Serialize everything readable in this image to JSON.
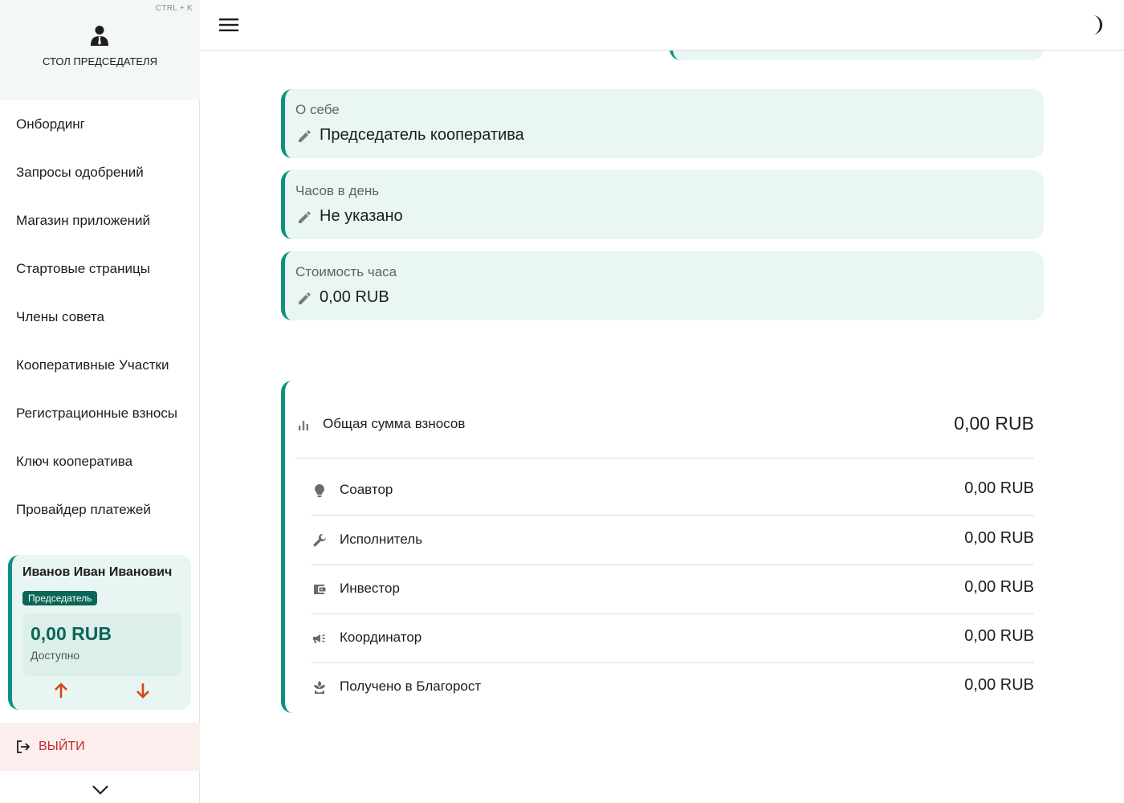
{
  "sidebar": {
    "shortcut": "CTRL + K",
    "title": "СТОЛ ПРЕДСЕДАТЕЛЯ",
    "items": [
      {
        "label": "Онбординг"
      },
      {
        "label": "Запросы одобрений"
      },
      {
        "label": "Магазин приложений"
      },
      {
        "label": "Стартовые страницы"
      },
      {
        "label": "Члены совета"
      },
      {
        "label": "Кооперативные Участки"
      },
      {
        "label": "Регистрационные взносы"
      },
      {
        "label": "Ключ кооператива"
      },
      {
        "label": "Провайдер платежей"
      }
    ],
    "user": {
      "name": "Иванов Иван Иванович",
      "role": "Председатель",
      "balance": "0,00 RUB",
      "balance_label": "Доступно"
    },
    "logout_label": "ВЫЙТИ"
  },
  "topbar": {
    "menu_icon": "menu-icon",
    "theme_icon": "dark-mode-icon"
  },
  "profile_fields": [
    {
      "label": "О себе",
      "value": "Председатель кооператива"
    },
    {
      "label": "Часов в день",
      "value": "Не указано"
    },
    {
      "label": "Стоимость часа",
      "value": "0,00 RUB"
    }
  ],
  "contributions": {
    "total": {
      "label": "Общая сумма взносов",
      "amount": "0,00 RUB",
      "icon": "bar-chart-icon"
    },
    "rows": [
      {
        "label": "Соавтор",
        "amount": "0,00 RUB",
        "icon": "lightbulb-icon"
      },
      {
        "label": "Исполнитель",
        "amount": "0,00 RUB",
        "icon": "wrench-icon"
      },
      {
        "label": "Инвестор",
        "amount": "0,00 RUB",
        "icon": "wallet-icon"
      },
      {
        "label": "Координатор",
        "amount": "0,00 RUB",
        "icon": "campaign-icon"
      },
      {
        "label": "Получено в Благорост",
        "amount": "0,00 RUB",
        "icon": "growth-icon"
      }
    ]
  },
  "colors": {
    "accent": "#0e9180",
    "accent_dark": "#0a6657",
    "card_bg": "#eaf6f4",
    "logout_bg": "#fdeeee",
    "logout_text": "#c62828",
    "arrow_color": "#d84315"
  }
}
